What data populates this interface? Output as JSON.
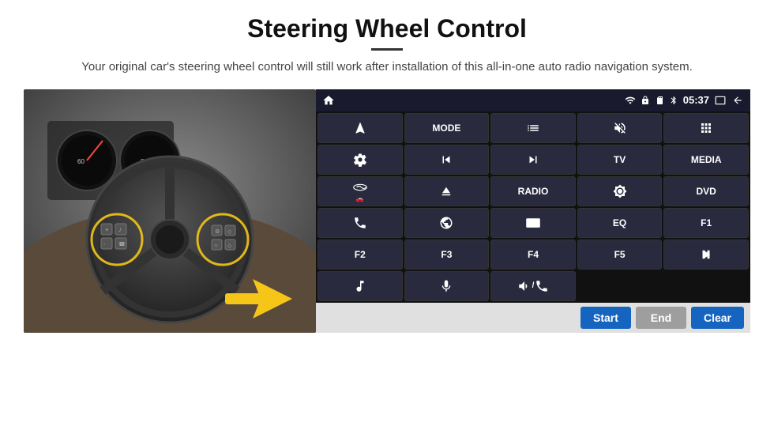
{
  "header": {
    "title": "Steering Wheel Control",
    "subtitle": "Your original car's steering wheel control will still work after installation of this all-in-one auto radio navigation system."
  },
  "status_bar": {
    "time": "05:37",
    "home_icon": "home",
    "wifi_icon": "wifi",
    "lock_icon": "lock",
    "sd_icon": "sd",
    "bt_icon": "bluetooth",
    "screen_icon": "screen",
    "back_icon": "back"
  },
  "buttons": [
    {
      "id": "nav",
      "label": "",
      "icon": "nav",
      "row": 1,
      "col": 1
    },
    {
      "id": "mode",
      "label": "MODE",
      "icon": "",
      "row": 1,
      "col": 2
    },
    {
      "id": "list",
      "label": "",
      "icon": "list",
      "row": 1,
      "col": 3
    },
    {
      "id": "mute",
      "label": "",
      "icon": "mute",
      "row": 1,
      "col": 4
    },
    {
      "id": "apps",
      "label": "",
      "icon": "apps",
      "row": 1,
      "col": 5
    },
    {
      "id": "settings",
      "label": "",
      "icon": "settings",
      "row": 2,
      "col": 1
    },
    {
      "id": "prev",
      "label": "",
      "icon": "prev",
      "row": 2,
      "col": 2
    },
    {
      "id": "next",
      "label": "",
      "icon": "next",
      "row": 2,
      "col": 3
    },
    {
      "id": "tv",
      "label": "TV",
      "icon": "",
      "row": 2,
      "col": 4
    },
    {
      "id": "media",
      "label": "MEDIA",
      "icon": "",
      "row": 2,
      "col": 5
    },
    {
      "id": "360",
      "label": "",
      "icon": "360",
      "row": 3,
      "col": 1
    },
    {
      "id": "eject",
      "label": "",
      "icon": "eject",
      "row": 3,
      "col": 2
    },
    {
      "id": "radio",
      "label": "RADIO",
      "icon": "",
      "row": 3,
      "col": 3
    },
    {
      "id": "brightness",
      "label": "",
      "icon": "brightness",
      "row": 3,
      "col": 4
    },
    {
      "id": "dvd",
      "label": "DVD",
      "icon": "",
      "row": 3,
      "col": 5
    },
    {
      "id": "phone",
      "label": "",
      "icon": "phone",
      "row": 4,
      "col": 1
    },
    {
      "id": "web",
      "label": "",
      "icon": "web",
      "row": 4,
      "col": 2
    },
    {
      "id": "screen",
      "label": "",
      "icon": "screen",
      "row": 4,
      "col": 3
    },
    {
      "id": "eq",
      "label": "EQ",
      "icon": "",
      "row": 4,
      "col": 4
    },
    {
      "id": "f1",
      "label": "F1",
      "icon": "",
      "row": 4,
      "col": 5
    },
    {
      "id": "f2",
      "label": "F2",
      "icon": "",
      "row": 5,
      "col": 1
    },
    {
      "id": "f3",
      "label": "F3",
      "icon": "",
      "row": 5,
      "col": 2
    },
    {
      "id": "f4",
      "label": "F4",
      "icon": "",
      "row": 5,
      "col": 3
    },
    {
      "id": "f5",
      "label": "F5",
      "icon": "",
      "row": 5,
      "col": 4
    },
    {
      "id": "playpause",
      "label": "",
      "icon": "playpause",
      "row": 5,
      "col": 5
    },
    {
      "id": "music",
      "label": "",
      "icon": "music",
      "row": 6,
      "col": 1
    },
    {
      "id": "mic",
      "label": "",
      "icon": "mic",
      "row": 6,
      "col": 2
    },
    {
      "id": "vol",
      "label": "",
      "icon": "vol",
      "row": 6,
      "col": 3
    }
  ],
  "action_bar": {
    "start_label": "Start",
    "end_label": "End",
    "clear_label": "Clear"
  }
}
